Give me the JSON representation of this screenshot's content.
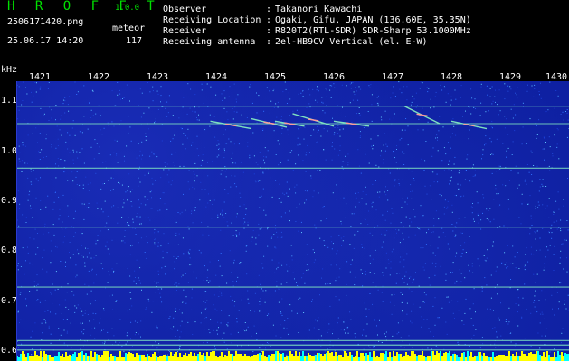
{
  "header": {
    "app_title": "H R O F F T",
    "app_version": "1.0.0",
    "filename": "2506171420.png",
    "datetime": "25.06.17 14:20",
    "meteor_label": "meteor",
    "meteor_count": "117",
    "info": [
      {
        "label": "Observer",
        "sep": ":",
        "value": "Takanori Kawachi"
      },
      {
        "label": "Receiving Location",
        "sep": ":",
        "value": "Ogaki, Gifu, JAPAN (136.60E, 35.35N)"
      },
      {
        "label": "Receiver",
        "sep": ":",
        "value": "R820T2(RTL-SDR) SDR-Sharp 53.1000MHz"
      },
      {
        "label": "Receiving antenna",
        "sep": ":",
        "value": "2el-HB9CV Vertical (el. E-W)"
      }
    ]
  },
  "chart_data": {
    "type": "heatmap",
    "x_unit": "time (HHMM)",
    "y_unit": "kHz",
    "x_ticks": [
      "1421",
      "1422",
      "1423",
      "1424",
      "1425",
      "1426",
      "1427",
      "1428",
      "1429",
      "1430"
    ],
    "y_label": "kHz",
    "y_ticks": [
      "1.1",
      "1.0",
      "0.9",
      "0.8",
      "0.7",
      "0.6"
    ],
    "ylim": [
      0.58,
      1.14
    ],
    "xlim": [
      1420.6,
      1430.0
    ],
    "colors": {
      "background": "#0d1fa0",
      "noise": "#3aa0ff",
      "carrier": "#7ee0c0",
      "echo": "#ff9999",
      "bottom_band": "#ffff00"
    },
    "carriers_khz": [
      1.09,
      1.055,
      0.966,
      0.848,
      0.728,
      0.621,
      0.612,
      0.602
    ],
    "meteor_echoes": [
      {
        "x_start": 1423.9,
        "x_end": 1424.6,
        "y_start": 1.06,
        "y_end": 1.045
      },
      {
        "x_start": 1424.6,
        "x_end": 1425.2,
        "y_start": 1.065,
        "y_end": 1.048
      },
      {
        "x_start": 1425.0,
        "x_end": 1425.5,
        "y_start": 1.06,
        "y_end": 1.05
      },
      {
        "x_start": 1425.3,
        "x_end": 1426.0,
        "y_start": 1.075,
        "y_end": 1.05
      },
      {
        "x_start": 1426.0,
        "x_end": 1426.6,
        "y_start": 1.06,
        "y_end": 1.05
      },
      {
        "x_start": 1427.2,
        "x_end": 1427.8,
        "y_start": 1.09,
        "y_end": 1.055
      },
      {
        "x_start": 1428.0,
        "x_end": 1428.6,
        "y_start": 1.06,
        "y_end": 1.045
      }
    ]
  }
}
